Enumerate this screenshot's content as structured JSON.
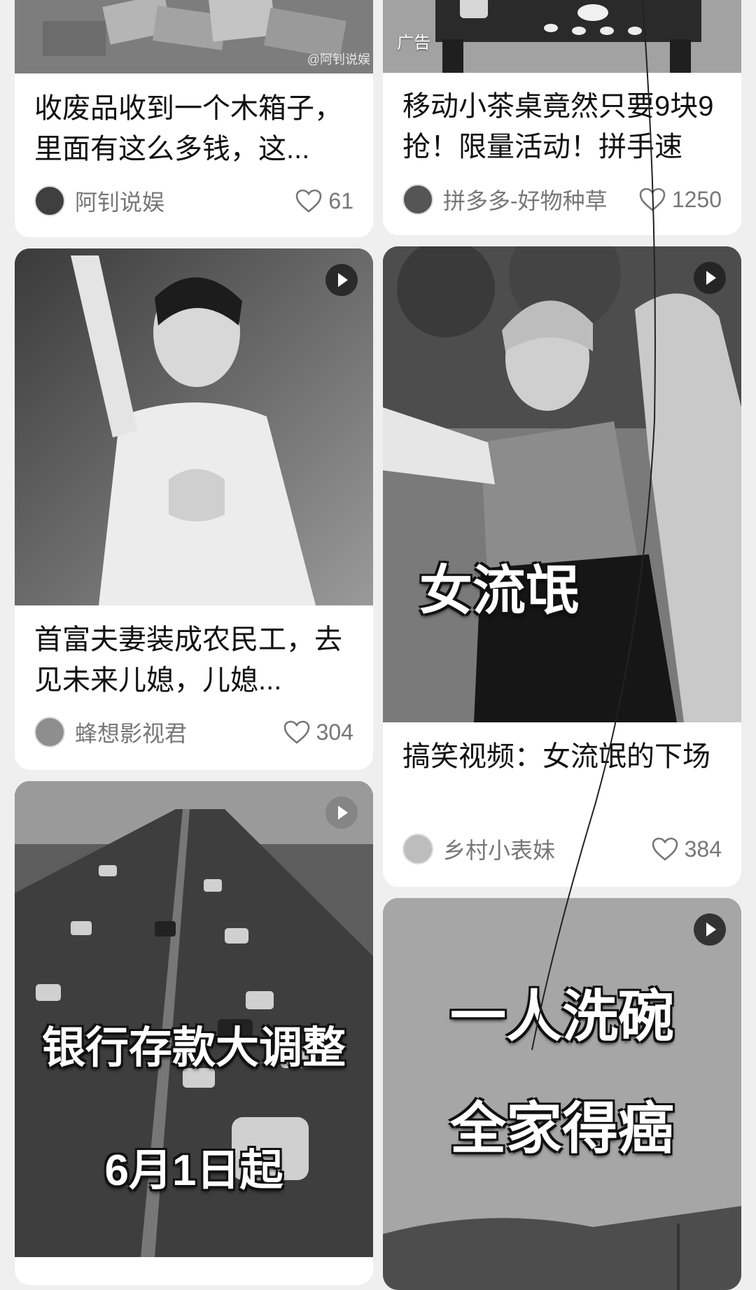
{
  "feed": {
    "left": [
      {
        "title": "收废品收到一个木箱子，里面有这么多钱，这...",
        "author": "阿钊说娱",
        "likes": "61",
        "image_watermark": "@阿钊说娱",
        "avatar_icon": "author-avatar"
      },
      {
        "title": "首富夫妻装成农民工，去见未来儿媳，儿媳...",
        "author": "蜂想影视君",
        "likes": "304",
        "has_play": true
      },
      {
        "overlay_line1": "银行存款大调整",
        "overlay_line2": "6月1日起",
        "has_play": true
      }
    ],
    "right": [
      {
        "title": "移动小茶桌竟然只要9块9抢！限量活动！拼手速",
        "author": "拼多多-好物种草",
        "likes": "1250",
        "ad_label": "广告"
      },
      {
        "title": "搞笑视频：女流氓的下场",
        "author": "乡村小表妹",
        "likes": "384",
        "overlay": "女流氓",
        "has_play": true
      },
      {
        "overlay_line1": "一人洗碗",
        "overlay_line2": "全家得癌",
        "has_play": true
      }
    ]
  },
  "icons": {
    "play": "play-icon",
    "like": "heart-outline-icon"
  },
  "colors": {
    "background": "#efefef",
    "card": "#ffffff",
    "text": "#111111",
    "muted": "#777777"
  }
}
